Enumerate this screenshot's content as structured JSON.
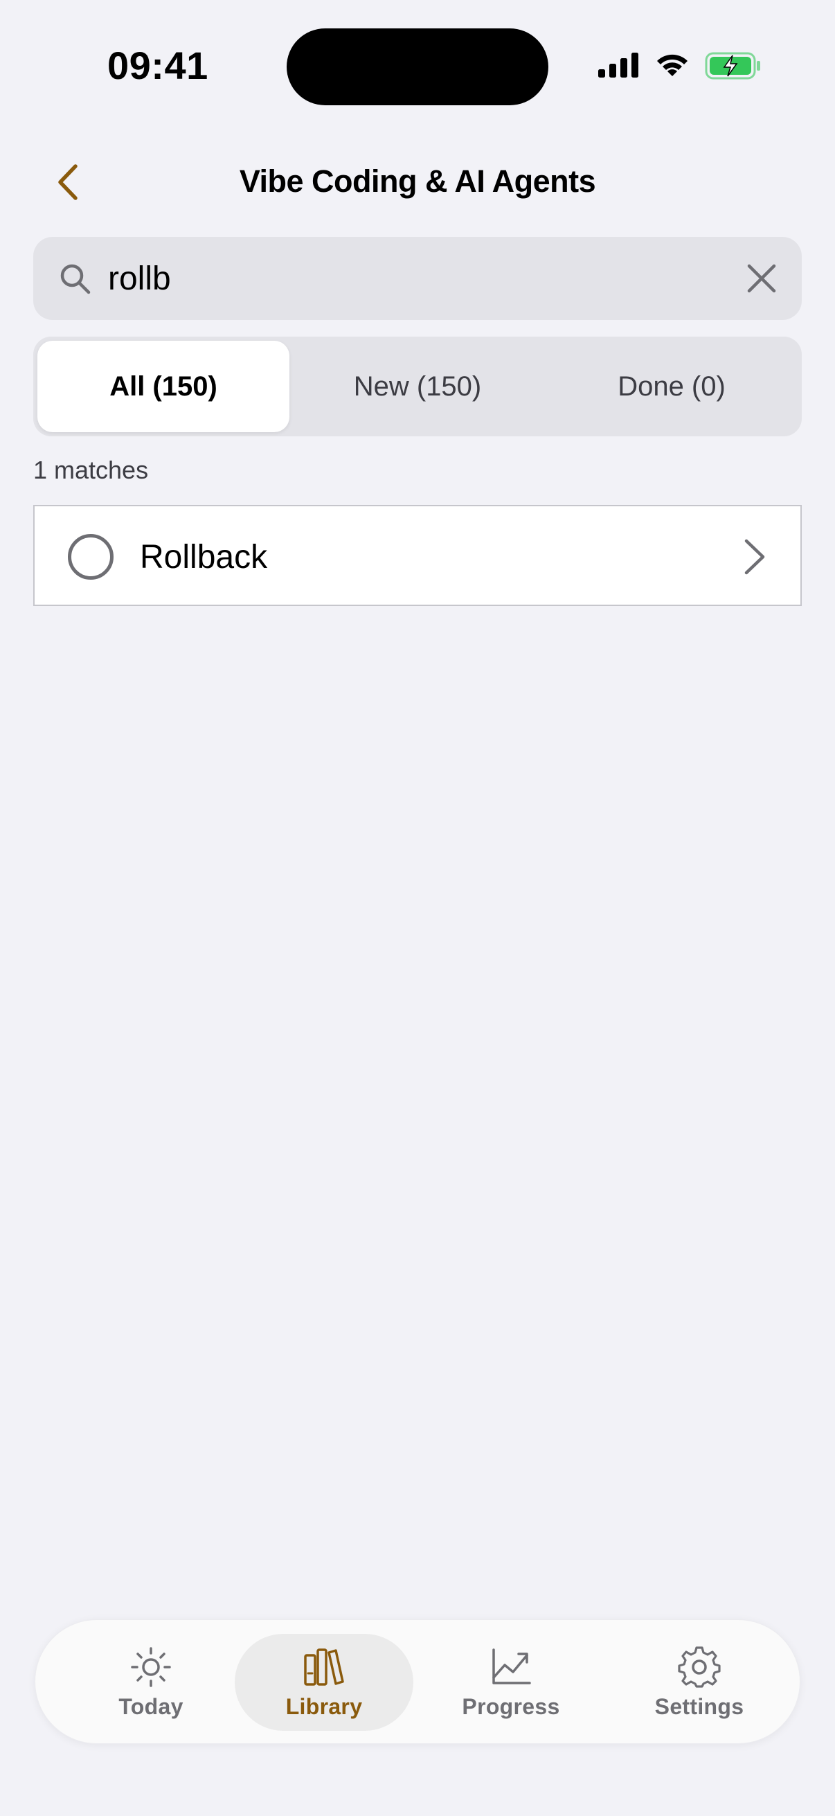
{
  "status_bar": {
    "time": "09:41"
  },
  "colors": {
    "accent": "#8a5a0c",
    "background": "#f2f2f7",
    "battery_green": "#34c759"
  },
  "nav": {
    "title": "Vibe Coding & AI Agents",
    "back_icon": "chevron-left-icon"
  },
  "search": {
    "value": "rollb",
    "placeholder": "Search",
    "clear_icon": "close-icon"
  },
  "segments": [
    {
      "label": "All (150)",
      "selected": true
    },
    {
      "label": "New (150)",
      "selected": false
    },
    {
      "label": "Done (0)",
      "selected": false
    }
  ],
  "results": {
    "count_label": "1 matches",
    "items": [
      {
        "label": "Rollback",
        "done": false
      }
    ]
  },
  "tabbar": {
    "tabs": [
      {
        "label": "Today",
        "icon": "sun-icon",
        "selected": false
      },
      {
        "label": "Library",
        "icon": "books-icon",
        "selected": true
      },
      {
        "label": "Progress",
        "icon": "chart-icon",
        "selected": false
      },
      {
        "label": "Settings",
        "icon": "gear-icon",
        "selected": false
      }
    ]
  }
}
